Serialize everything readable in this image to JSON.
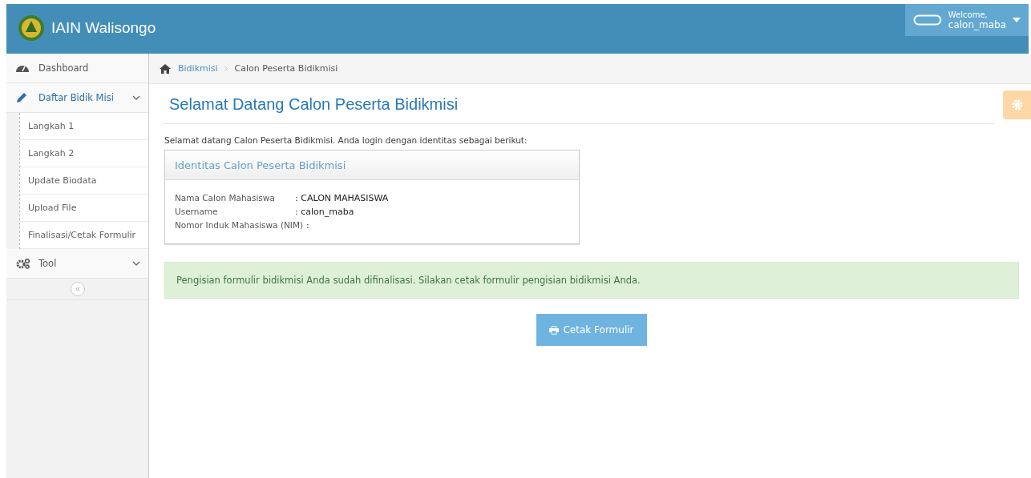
{
  "navbar": {
    "brand": "IAIN Walisongo",
    "user": {
      "greeting": "Welcome,",
      "name": "calon_maba"
    }
  },
  "sidebar": {
    "items": [
      {
        "label": "Dashboard"
      },
      {
        "label": "Daftar Bidik Misi",
        "expanded": true,
        "children": [
          {
            "label": "Langkah 1"
          },
          {
            "label": "Langkah 2"
          },
          {
            "label": "Update Biodata"
          },
          {
            "label": "Upload File"
          },
          {
            "label": "Finalisasi/Cetak Formulir"
          }
        ]
      },
      {
        "label": "Tool",
        "expanded": false
      }
    ]
  },
  "breadcrumb": [
    {
      "label": "Bidikmisi",
      "link": true
    },
    {
      "label": "Calon Peserta Bidikmisi",
      "link": false
    }
  ],
  "page_title": "Selamat Datang Calon Peserta Bidikmisi",
  "intro": "Selamat datang Calon Peserta Bidikmisi. Anda login dengan identitas sebagai berikut:",
  "identity_box": {
    "title": "Identitas Calon Peserta Bidikmisi",
    "rows": [
      {
        "label": "Nama Calon Mahasiswa",
        "value": ": CALON MAHASISWA"
      },
      {
        "label": "Username",
        "value": ": calon_maba"
      },
      {
        "label": "Nomor Induk Mahasiswa (NIM)",
        "value": ":"
      }
    ]
  },
  "alert": "Pengisian formulir bidikmisi Anda sudah difinalisasi. Silakan cetak formulir pengisian bidikmisi Anda.",
  "print_button": "Cetak Formulir"
}
